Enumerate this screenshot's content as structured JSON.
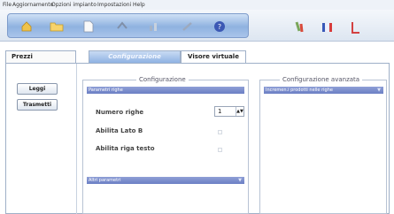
{
  "menu": [
    "File",
    "Aggiornamento",
    "Opzioni impianto",
    "Impostazioni",
    "Help"
  ],
  "toolbar": {
    "icons": [
      "home-icon",
      "folder-icon",
      "document-icon",
      "sync-icon",
      "chart-icon",
      "tools-icon",
      "help-icon"
    ],
    "right_icons": [
      "italian-flag-icon",
      "french-flag-icon",
      "english-flag-icon"
    ]
  },
  "tabs": {
    "prezzi": "Prezzi",
    "configurazione": "Configurazione",
    "visore": "Visore virtuale"
  },
  "buttons": {
    "leggi": "Leggi",
    "trasmetti": "Trasmetti"
  },
  "configurazione": {
    "title": "Configurazione",
    "section1": "Parametri righe",
    "numero_righe_label": "Numero righe",
    "numero_righe_value": "1",
    "abilita_lato_b": "Abilita Lato B",
    "abilita_riga_testo": "Abilita riga testo",
    "section2": "Altri parametri"
  },
  "avanzata": {
    "title": "Configurazione avanzata",
    "section1": "Incremen.i prodotti nelle righe"
  },
  "colors": {
    "accent": "#6b7fc4",
    "toolbar": "#8fb2e0"
  }
}
